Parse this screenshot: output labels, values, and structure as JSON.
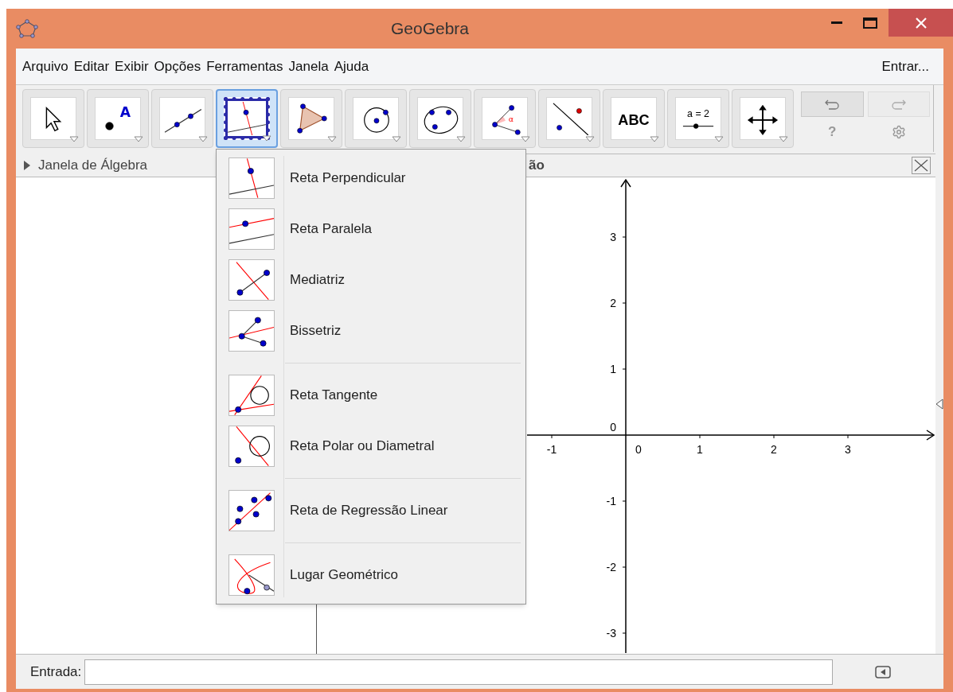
{
  "window": {
    "title": "GeoGebra"
  },
  "menu_bar": {
    "items": [
      "Arquivo",
      "Editar",
      "Exibir",
      "Opções",
      "Ferramentas",
      "Janela",
      "Ajuda"
    ],
    "login": "Entrar..."
  },
  "toolbar": {
    "tools": [
      {
        "kind": "move",
        "selected": false
      },
      {
        "kind": "point",
        "selected": false,
        "label": "A"
      },
      {
        "kind": "line",
        "selected": false
      },
      {
        "kind": "perpendicular",
        "selected": true
      },
      {
        "kind": "polygon",
        "selected": false
      },
      {
        "kind": "circle",
        "selected": false
      },
      {
        "kind": "conic",
        "selected": false
      },
      {
        "kind": "angle",
        "selected": false,
        "label": "α"
      },
      {
        "kind": "reflect",
        "selected": false
      },
      {
        "kind": "text",
        "selected": false,
        "label": "ABC"
      },
      {
        "kind": "slider",
        "selected": false,
        "label": "a = 2"
      },
      {
        "kind": "pan",
        "selected": false
      }
    ],
    "undo": {
      "disabled": false
    },
    "redo": {
      "disabled": true
    },
    "help": "?"
  },
  "algebra_view": {
    "title": "Janela de Álgebra"
  },
  "graphics_view": {
    "title": "ão",
    "x_ticks": [
      "-1",
      "0",
      "1",
      "2",
      "3"
    ],
    "y_ticks": [
      "3",
      "2",
      "1",
      "0",
      "-1",
      "-2",
      "-3"
    ]
  },
  "dropdown": {
    "groups": [
      {
        "items": [
          {
            "kind": "perpendicular",
            "label": "Reta Perpendicular"
          },
          {
            "kind": "parallel",
            "label": "Reta Paralela"
          },
          {
            "kind": "bisector",
            "label": "Mediatriz"
          },
          {
            "kind": "anglebisector",
            "label": "Bissetriz"
          }
        ]
      },
      {
        "items": [
          {
            "kind": "tangent",
            "label": "Reta Tangente"
          },
          {
            "kind": "polar",
            "label": "Reta Polar ou Diametral"
          }
        ]
      },
      {
        "items": [
          {
            "kind": "regression",
            "label": "Reta de Regressão Linear"
          }
        ]
      },
      {
        "items": [
          {
            "kind": "locus",
            "label": "Lugar Geométrico"
          }
        ]
      }
    ]
  },
  "input_bar": {
    "label": "Entrada:"
  }
}
